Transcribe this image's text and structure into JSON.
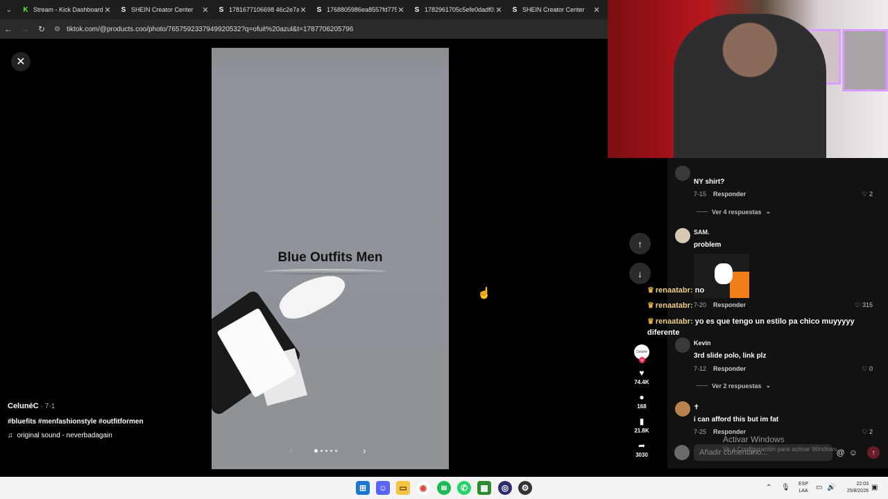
{
  "browser": {
    "tabs": [
      {
        "icon": "kick-icon",
        "label": "Stream - Kick Dashboard"
      },
      {
        "icon": "shein-icon",
        "label": "SHEIN Creator Center"
      },
      {
        "icon": "shein-icon",
        "label": "1781677106698 46c2e7af2..."
      },
      {
        "icon": "shein-icon",
        "label": "1768805986ea8557fd775f..."
      },
      {
        "icon": "shein-icon",
        "label": "1782961705c5efe0dadf01..."
      },
      {
        "icon": "shein-icon",
        "label": "SHEIN Creator Center"
      }
    ],
    "url": "tiktok.com/@products.coo/photo/7657592337949920532?q=ofuit%20azul&t=1787706205796"
  },
  "post": {
    "overlay_text": "Blue Outfits Men",
    "author": "CelunéC",
    "date": "· 7-1",
    "hashtags": "#bluefits #menfashionstyle #outfitformen",
    "sound": "original sound - neverbadagain",
    "slide_count": 5,
    "active_slide": 0
  },
  "actions": {
    "avatar_text": "Celuné",
    "likes": "74.4K",
    "comments": "168",
    "saves": "21.8K",
    "shares": "3030"
  },
  "comments": [
    {
      "text": "NY shirt?",
      "date": "7-15",
      "reply": "Responder",
      "likes": "2",
      "more": "Ver 4 respuestas"
    },
    {
      "user": "SAM.",
      "text": "problem",
      "date": "7-20",
      "reply": "Responder",
      "likes": "315"
    },
    {
      "user": "Kevin",
      "text": "3rd slide polo, link plz",
      "date": "7-12",
      "reply": "Responder",
      "likes": "0",
      "more": "Ver 2 respuestas"
    },
    {
      "user": "✝",
      "text": "i can afford this but im fat",
      "date": "7-25",
      "reply": "Responder",
      "likes": "2"
    }
  ],
  "chat": [
    {
      "user": "renaatabr:",
      "msg": "no"
    },
    {
      "user": "renaatabr:",
      "msg": ""
    },
    {
      "user": "renaatabr:",
      "msg": "yo es que tengo un estilo pa chico muyyyyy diferente"
    }
  ],
  "comment_input": {
    "placeholder": "Añadir comentario..."
  },
  "windows": {
    "activate": "Activar Windows",
    "activate_sub": "Ve a Configuración para activar Windows.",
    "lang": [
      "ESP",
      "LAA"
    ],
    "time": "22:03",
    "date": "25/8/2026"
  }
}
